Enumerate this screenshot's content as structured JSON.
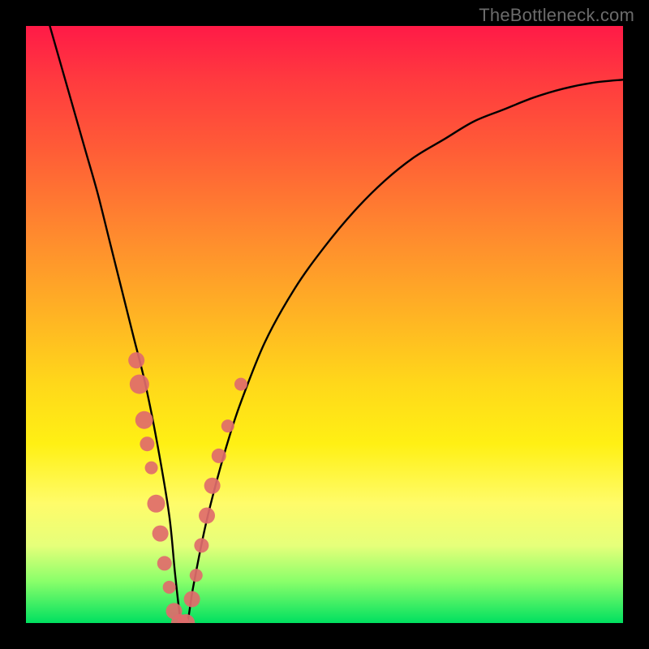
{
  "attribution": "TheBottleneck.com",
  "chart_data": {
    "type": "line",
    "title": "",
    "xlabel": "",
    "ylabel": "",
    "xlim": [
      0,
      100
    ],
    "ylim": [
      0,
      100
    ],
    "series": [
      {
        "name": "bottleneck-curve",
        "x": [
          4,
          6,
          8,
          10,
          12,
          14,
          16,
          18,
          20,
          22,
          24,
          25,
          26,
          27,
          28,
          30,
          32,
          34,
          36,
          40,
          45,
          50,
          55,
          60,
          65,
          70,
          75,
          80,
          85,
          90,
          95,
          100
        ],
        "values": [
          100,
          93,
          86,
          79,
          72,
          64,
          56,
          48,
          40,
          30,
          18,
          8,
          0,
          0,
          6,
          16,
          24,
          31,
          37,
          47,
          56,
          63,
          69,
          74,
          78,
          81,
          84,
          86,
          88,
          89.5,
          90.5,
          91
        ]
      }
    ],
    "markers": {
      "name": "highlight-points",
      "color": "#e06b6b",
      "points": [
        {
          "x": 18.5,
          "y": 44,
          "r": 10
        },
        {
          "x": 19.0,
          "y": 40,
          "r": 12
        },
        {
          "x": 19.8,
          "y": 34,
          "r": 11
        },
        {
          "x": 20.3,
          "y": 30,
          "r": 9
        },
        {
          "x": 21.0,
          "y": 26,
          "r": 8
        },
        {
          "x": 21.8,
          "y": 20,
          "r": 11
        },
        {
          "x": 22.5,
          "y": 15,
          "r": 10
        },
        {
          "x": 23.2,
          "y": 10,
          "r": 9
        },
        {
          "x": 24.0,
          "y": 6,
          "r": 8
        },
        {
          "x": 24.8,
          "y": 2,
          "r": 10
        },
        {
          "x": 25.8,
          "y": 0,
          "r": 11
        },
        {
          "x": 26.8,
          "y": 0,
          "r": 11
        },
        {
          "x": 27.8,
          "y": 4,
          "r": 10
        },
        {
          "x": 28.5,
          "y": 8,
          "r": 8
        },
        {
          "x": 29.4,
          "y": 13,
          "r": 9
        },
        {
          "x": 30.3,
          "y": 18,
          "r": 10
        },
        {
          "x": 31.2,
          "y": 23,
          "r": 10
        },
        {
          "x": 32.3,
          "y": 28,
          "r": 9
        },
        {
          "x": 33.8,
          "y": 33,
          "r": 8
        },
        {
          "x": 36.0,
          "y": 40,
          "r": 8
        }
      ]
    }
  }
}
